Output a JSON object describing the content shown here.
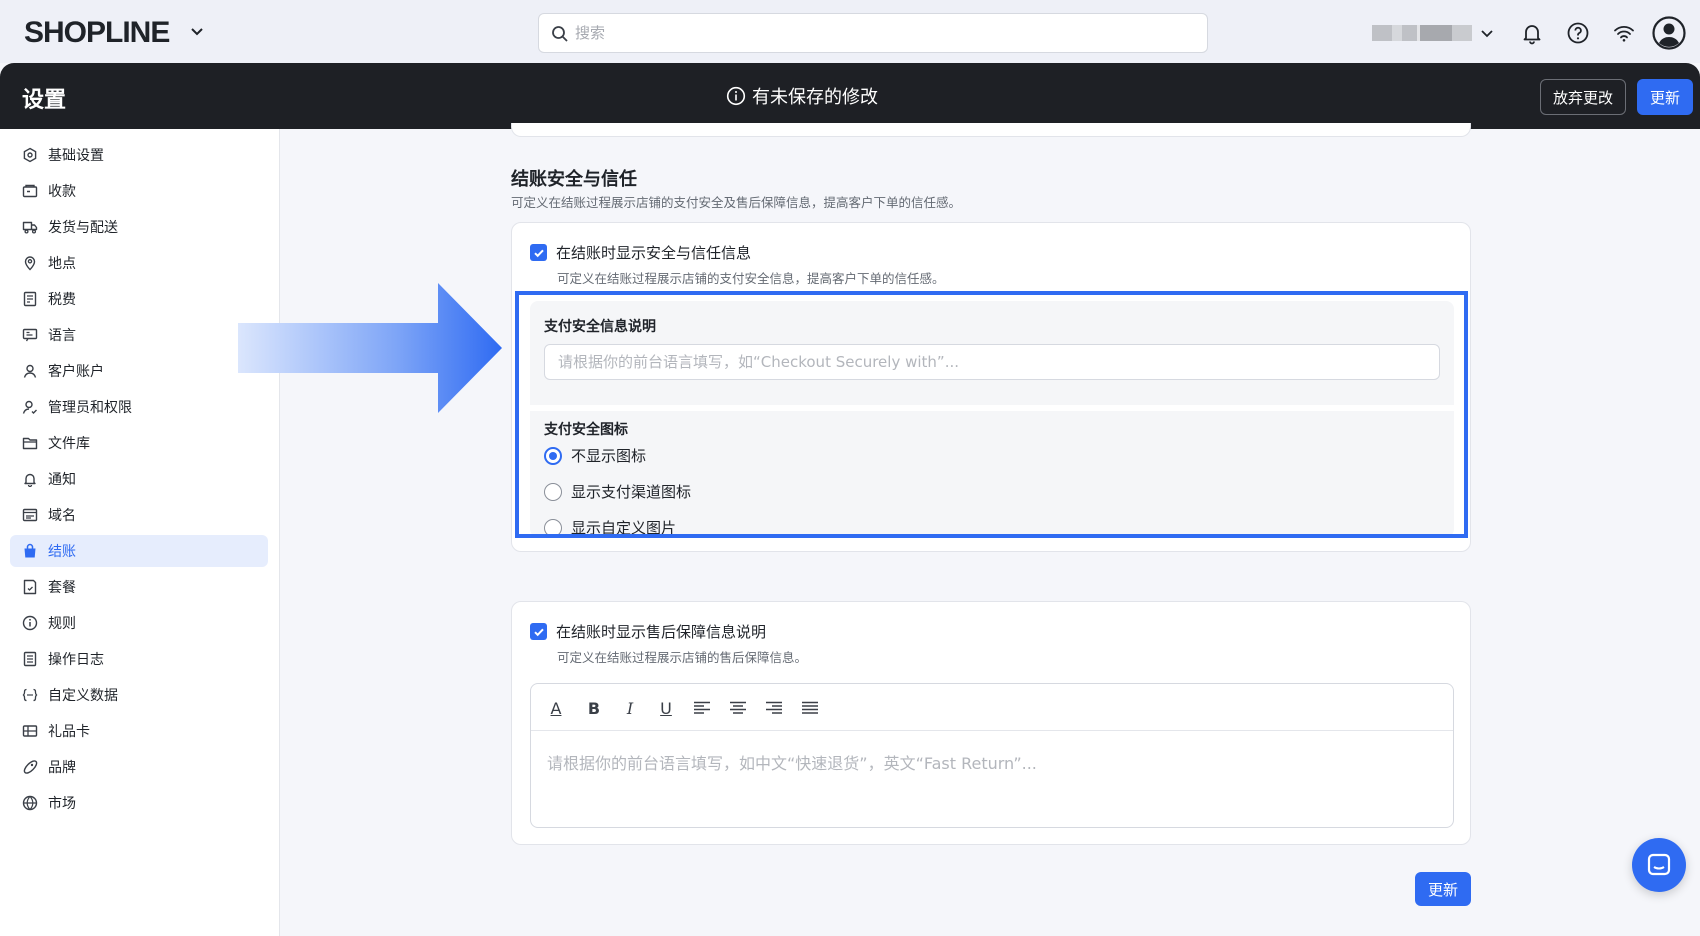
{
  "topbar": {
    "logo": "SHOPLINE",
    "search_placeholder": "搜索"
  },
  "header": {
    "title": "设置",
    "unsaved_notice": "有未保存的修改",
    "discard_label": "放弃更改",
    "update_label": "更新"
  },
  "sidebar": {
    "items": [
      {
        "label": "基础设置",
        "icon": "settings-icon"
      },
      {
        "label": "收款",
        "icon": "payment-icon"
      },
      {
        "label": "发货与配送",
        "icon": "truck-icon"
      },
      {
        "label": "地点",
        "icon": "location-icon"
      },
      {
        "label": "税费",
        "icon": "tax-icon"
      },
      {
        "label": "语言",
        "icon": "language-icon"
      },
      {
        "label": "客户账户",
        "icon": "user-icon"
      },
      {
        "label": "管理员和权限",
        "icon": "admin-icon"
      },
      {
        "label": "文件库",
        "icon": "folder-icon"
      },
      {
        "label": "通知",
        "icon": "bell-icon"
      },
      {
        "label": "域名",
        "icon": "domain-icon"
      },
      {
        "label": "结账",
        "icon": "checkout-bag-icon",
        "active": true
      },
      {
        "label": "套餐",
        "icon": "plan-icon"
      },
      {
        "label": "规则",
        "icon": "info-icon"
      },
      {
        "label": "操作日志",
        "icon": "log-icon"
      },
      {
        "label": "自定义数据",
        "icon": "custom-data-icon"
      },
      {
        "label": "礼品卡",
        "icon": "gift-card-icon"
      },
      {
        "label": "品牌",
        "icon": "brand-icon"
      },
      {
        "label": "市场",
        "icon": "globe-icon"
      }
    ]
  },
  "section": {
    "title": "结账安全与信任",
    "description": "可定义在结账过程展示店铺的支付安全及售后保障信息，提高客户下单的信任感。"
  },
  "security_card": {
    "checkbox_label": "在结账时显示安全与信任信息",
    "checkbox_checked": true,
    "checkbox_desc": "可定义在结账过程展示店铺的支付安全信息，提高客户下单的信任感。",
    "field_label": "支付安全信息说明",
    "field_placeholder": "请根据你的前台语言填写，如“Checkout Securely with”...",
    "field_value": "",
    "icon_label": "支付安全图标",
    "icon_options": [
      {
        "label": "不显示图标",
        "selected": true
      },
      {
        "label": "显示支付渠道图标",
        "selected": false
      },
      {
        "label": "显示自定义图片",
        "selected": false
      }
    ]
  },
  "aftersale_card": {
    "checkbox_label": "在结账时显示售后保障信息说明",
    "checkbox_checked": true,
    "checkbox_desc": "可定义在结账过程展示店铺的售后保障信息。",
    "editor_placeholder": "请根据你的前台语言填写，如中文“快速退货”，英文“Fast Return”...",
    "toolbar": {
      "text_color": "A",
      "bold": "B",
      "italic": "I",
      "underline": "U"
    }
  },
  "footer": {
    "update_label": "更新"
  },
  "colors": {
    "accent": "#2f6bf2",
    "header_bg": "#1e2025",
    "active_nav_bg": "#e6edfd"
  }
}
